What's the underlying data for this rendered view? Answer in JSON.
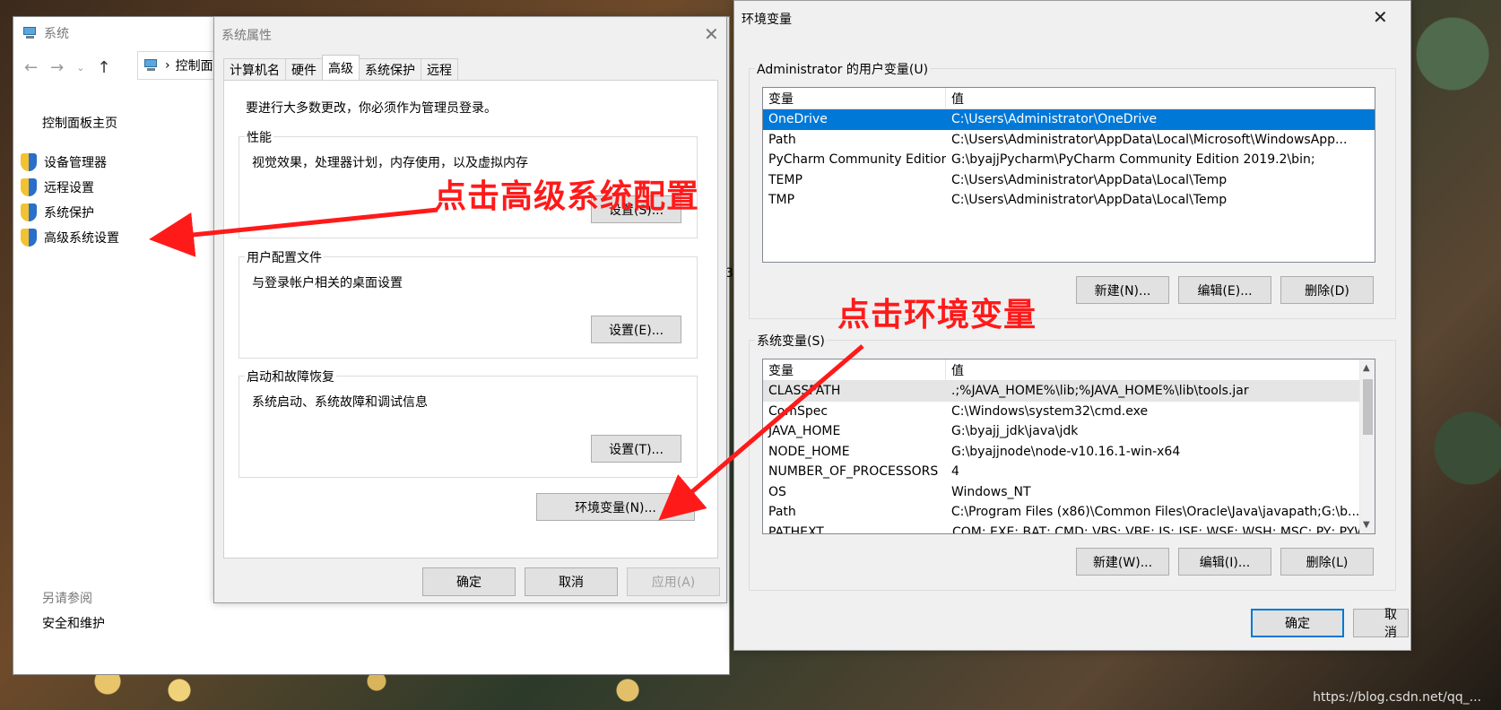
{
  "system_window": {
    "title": "系统",
    "address": "控制面板",
    "home_link": "控制面板主页",
    "side_items": [
      {
        "label": "设备管理器"
      },
      {
        "label": "远程设置"
      },
      {
        "label": "系统保护"
      },
      {
        "label": "高级系统设置"
      }
    ],
    "see_also": "另请参阅",
    "security_link": "安全和维护",
    "partial_text": "3"
  },
  "properties_dialog": {
    "title": "系统属性",
    "close_glyph": "✕",
    "tabs": [
      {
        "label": "计算机名"
      },
      {
        "label": "硬件"
      },
      {
        "label": "高级"
      },
      {
        "label": "系统保护"
      },
      {
        "label": "远程"
      }
    ],
    "admin_note": "要进行大多数更改，你必须作为管理员登录。",
    "performance": {
      "label": "性能",
      "desc": "视觉效果，处理器计划，内存使用，以及虚拟内存",
      "button": "设置(S)..."
    },
    "user_profiles": {
      "label": "用户配置文件",
      "desc": "与登录帐户相关的桌面设置",
      "button": "设置(E)..."
    },
    "startup_recovery": {
      "label": "启动和故障恢复",
      "desc": "系统启动、系统故障和调试信息",
      "button": "设置(T)..."
    },
    "env_button": "环境变量(N)...",
    "ok": "确定",
    "cancel": "取消",
    "apply": "应用(A)"
  },
  "env_dialog": {
    "title": "环境变量",
    "close_glyph": "✕",
    "user_group_label": "Administrator 的用户变量(U)",
    "col_var": "变量",
    "col_val": "值",
    "user_vars": [
      {
        "name": "OneDrive",
        "value": "C:\\Users\\Administrator\\OneDrive"
      },
      {
        "name": "Path",
        "value": "C:\\Users\\Administrator\\AppData\\Local\\Microsoft\\WindowsApp..."
      },
      {
        "name": "PyCharm Community Edition",
        "value": "G:\\byajjPycharm\\PyCharm Community Edition 2019.2\\bin;"
      },
      {
        "name": "TEMP",
        "value": "C:\\Users\\Administrator\\AppData\\Local\\Temp"
      },
      {
        "name": "TMP",
        "value": "C:\\Users\\Administrator\\AppData\\Local\\Temp"
      }
    ],
    "user_new": "新建(N)...",
    "user_edit": "编辑(E)...",
    "user_delete": "删除(D)",
    "sys_group_label": "系统变量(S)",
    "sys_vars": [
      {
        "name": "CLASSPATH",
        "value": ".;%JAVA_HOME%\\lib;%JAVA_HOME%\\lib\\tools.jar"
      },
      {
        "name": "ComSpec",
        "value": "C:\\Windows\\system32\\cmd.exe"
      },
      {
        "name": "JAVA_HOME",
        "value": "G:\\byajj_jdk\\java\\jdk"
      },
      {
        "name": "NODE_HOME",
        "value": "G:\\byajjnode\\node-v10.16.1-win-x64"
      },
      {
        "name": "NUMBER_OF_PROCESSORS",
        "value": "4"
      },
      {
        "name": "OS",
        "value": "Windows_NT"
      },
      {
        "name": "Path",
        "value": "C:\\Program Files (x86)\\Common Files\\Oracle\\Java\\javapath;G:\\b..."
      },
      {
        "name": "PATHEXT",
        "value": ".COM;.EXE;.BAT;.CMD;.VBS;.VBE;.JS;.JSE;.WSF;.WSH;.MSC;.PY;.PYW"
      }
    ],
    "sys_new": "新建(W)...",
    "sys_edit": "编辑(I)...",
    "sys_delete": "删除(L)",
    "ok": "确定",
    "cancel": "取消"
  },
  "annotations": {
    "click_advanced": "点击高级系统配置",
    "click_env": "点击环境变量",
    "color": "#ff1a1a"
  },
  "watermark": "https://blog.csdn.net/qq_..."
}
